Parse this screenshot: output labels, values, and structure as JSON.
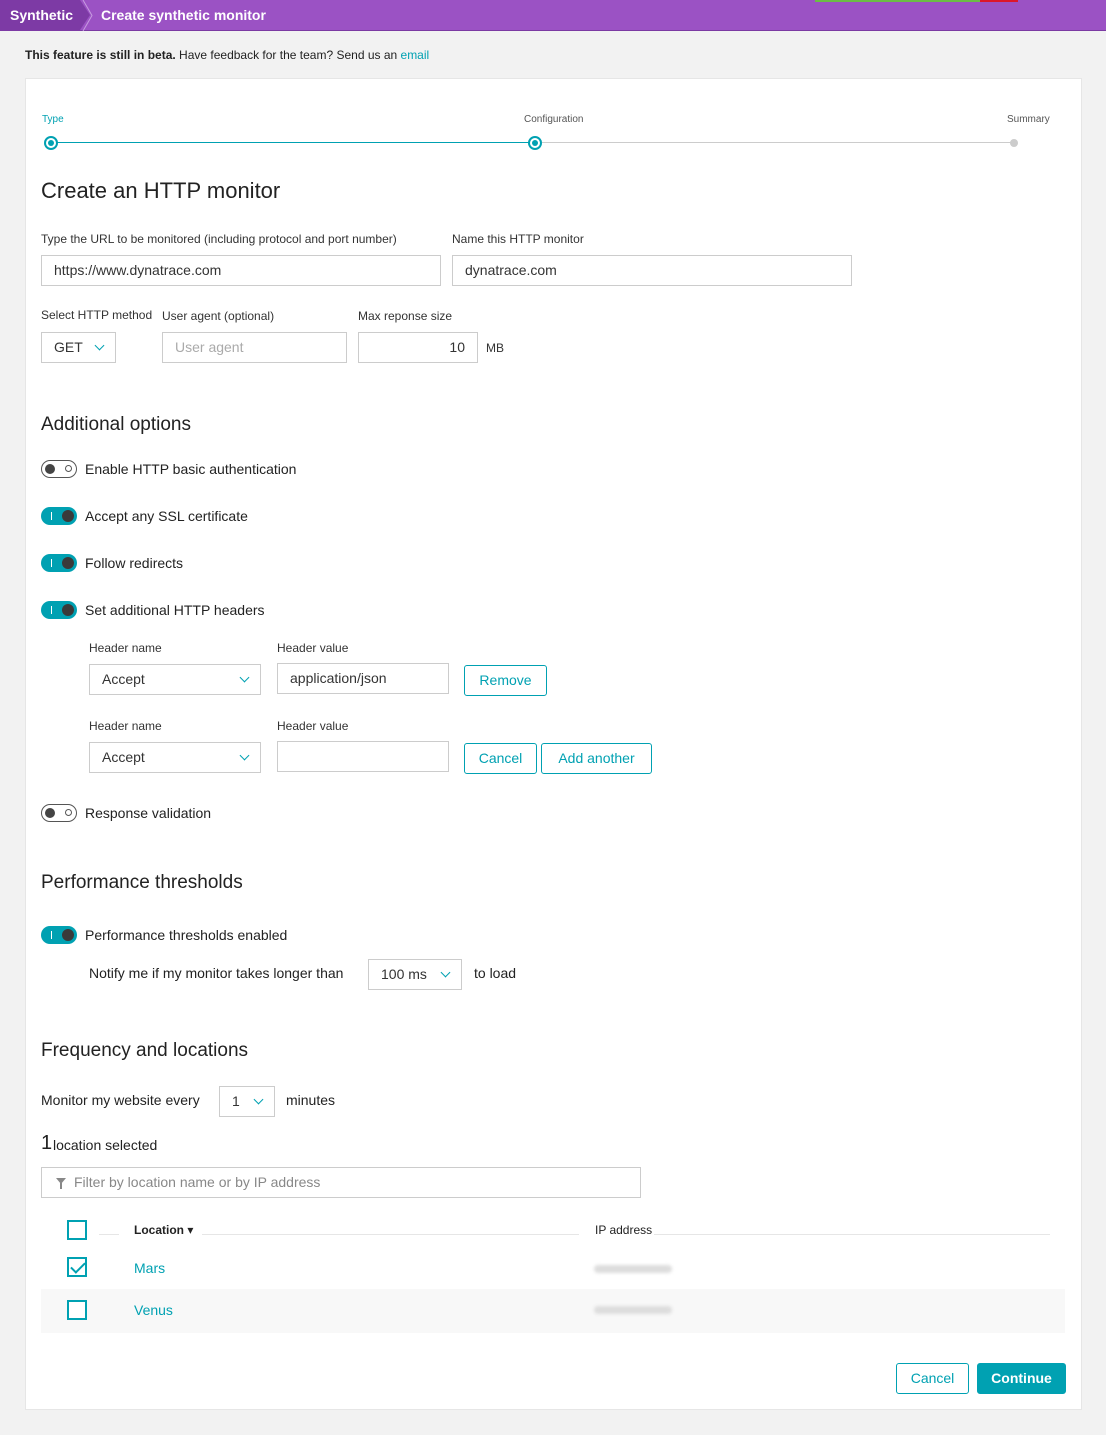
{
  "breadcrumb": {
    "root": "Synthetic",
    "current": "Create synthetic monitor"
  },
  "beta": {
    "bold": "This feature is still in beta.",
    "text": " Have feedback for the team? Send us an ",
    "link": "email"
  },
  "steps": [
    {
      "label": "Type",
      "state": "done"
    },
    {
      "label": "Configuration",
      "state": "current"
    },
    {
      "label": "Summary",
      "state": "pending"
    }
  ],
  "title": "Create an HTTP monitor",
  "url": {
    "label": "Type the URL to be monitored (including protocol and port number)",
    "value": "https://www.dynatrace.com"
  },
  "name": {
    "label": "Name this HTTP monitor",
    "value": "dynatrace.com"
  },
  "method": {
    "label": "Select HTTP method",
    "value": "GET"
  },
  "user_agent": {
    "label": "User agent (optional)",
    "placeholder": "User agent"
  },
  "max_size": {
    "label": "Max reponse size",
    "value": "10",
    "unit": "MB"
  },
  "additional": {
    "heading": "Additional options",
    "basic_auth": {
      "label": "Enable HTTP basic authentication",
      "on": false
    },
    "ssl": {
      "label": "Accept any SSL certificate",
      "on": true
    },
    "redirects": {
      "label": "Follow redirects",
      "on": true
    },
    "headers": {
      "label": "Set additional HTTP headers",
      "on": true,
      "name_label": "Header name",
      "value_label": "Header value",
      "rows": [
        {
          "name": "Accept",
          "value": "application/json"
        },
        {
          "name": "Accept",
          "value": ""
        }
      ],
      "remove": "Remove",
      "cancel": "Cancel",
      "add_another": "Add another"
    },
    "validation": {
      "label": "Response validation",
      "on": false
    }
  },
  "performance": {
    "heading": "Performance thresholds",
    "enabled": {
      "label": "Performance thresholds enabled",
      "on": true
    },
    "notify_prefix": "Notify me if my monitor takes longer than",
    "threshold": "100 ms",
    "notify_suffix": "to load"
  },
  "frequency": {
    "heading": "Frequency and locations",
    "prefix": "Monitor my website every",
    "value": "1",
    "suffix": "minutes",
    "count": "1",
    "count_label": "location selected",
    "filter_placeholder": "Filter by location name or by IP address",
    "col_location": "Location ▾",
    "col_ip": "IP address",
    "locations": [
      {
        "name": "Mars",
        "checked": true
      },
      {
        "name": "Venus",
        "checked": false
      }
    ]
  },
  "footer": {
    "cancel": "Cancel",
    "continue": "Continue"
  },
  "colors": {
    "accent": "#00a1b2",
    "header": "#9b52c4"
  }
}
